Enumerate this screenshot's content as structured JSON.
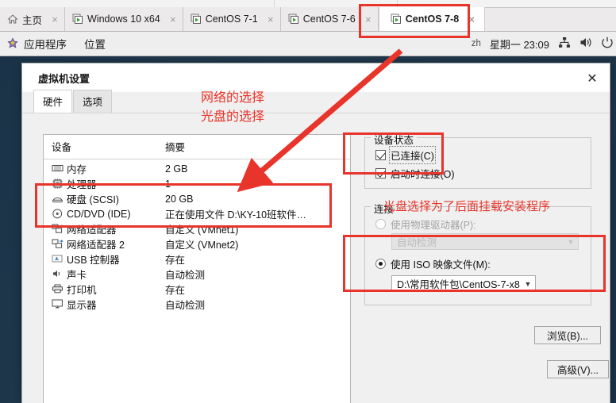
{
  "vmware_tabs": [
    {
      "label": "主页",
      "icon": "home-icon",
      "active": false,
      "closable": true
    },
    {
      "label": "Windows 10 x64",
      "icon": "vm-icon",
      "active": false,
      "closable": true
    },
    {
      "label": "CentOS 7-1",
      "icon": "vm-icon",
      "active": false,
      "closable": true
    },
    {
      "label": "CentOS 7-6",
      "icon": "vm-icon",
      "active": false,
      "closable": true
    },
    {
      "label": "CentOS 7-8",
      "icon": "vm-icon",
      "active": true,
      "closable": true
    }
  ],
  "close_glyph": "×",
  "gnome_panel": {
    "applications": "应用程序",
    "places": "位置",
    "input_method": "zh",
    "clock": "星期一  23:09",
    "network_icon": "network-icon",
    "volume_icon": "volume-icon",
    "power_icon": "power-icon"
  },
  "dialog": {
    "title": "虚拟机设置",
    "close_glyph": "✕",
    "tabs": [
      {
        "label": "硬件",
        "selected": true
      },
      {
        "label": "选项",
        "selected": false
      }
    ],
    "device_table": {
      "headers": [
        "设备",
        "摘要"
      ],
      "rows": [
        {
          "icon": "memory-icon",
          "device": "内存",
          "summary": "2 GB"
        },
        {
          "icon": "cpu-icon",
          "device": "处理器",
          "summary": "1"
        },
        {
          "icon": "harddisk-icon",
          "device": "硬盘 (SCSI)",
          "summary": "20 GB"
        },
        {
          "icon": "cddvd-icon",
          "device": "CD/DVD (IDE)",
          "summary": "正在使用文件 D:\\KY-10班软件…"
        },
        {
          "icon": "network-adapter-icon",
          "device": "网络适配器",
          "summary": "自定义 (VMnet1)"
        },
        {
          "icon": "network-adapter-icon",
          "device": "网络适配器 2",
          "summary": "自定义 (VMnet2)"
        },
        {
          "icon": "usb-icon",
          "device": "USB 控制器",
          "summary": "存在"
        },
        {
          "icon": "sound-icon",
          "device": "声卡",
          "summary": "自动检测"
        },
        {
          "icon": "printer-icon",
          "device": "打印机",
          "summary": "存在"
        },
        {
          "icon": "display-icon",
          "device": "显示器",
          "summary": "自动检测"
        }
      ]
    },
    "device_status": {
      "legend": "设备状态",
      "connected": {
        "label": "已连接(C)",
        "checked": true
      },
      "connect_at_power_on": {
        "label": "启动时连接(O)",
        "checked": true
      }
    },
    "connection": {
      "legend": "连接",
      "physical_drive": {
        "label": "使用物理驱动器(P):",
        "selected": false,
        "disabled": true
      },
      "physical_drive_value": "自动检测",
      "iso_image": {
        "label": "使用 ISO 映像文件(M):",
        "selected": true
      },
      "iso_path": "D:\\常用软件包\\CentOS-7-x8",
      "browse_button": "浏览(B)...",
      "advanced_button": "高级(V)..."
    }
  },
  "annotations": {
    "note_network": "网络的选择",
    "note_disc": "光盘的选择",
    "note_iso": "光盘选择为了后面挂载安装程序",
    "red": "#e8342a"
  }
}
